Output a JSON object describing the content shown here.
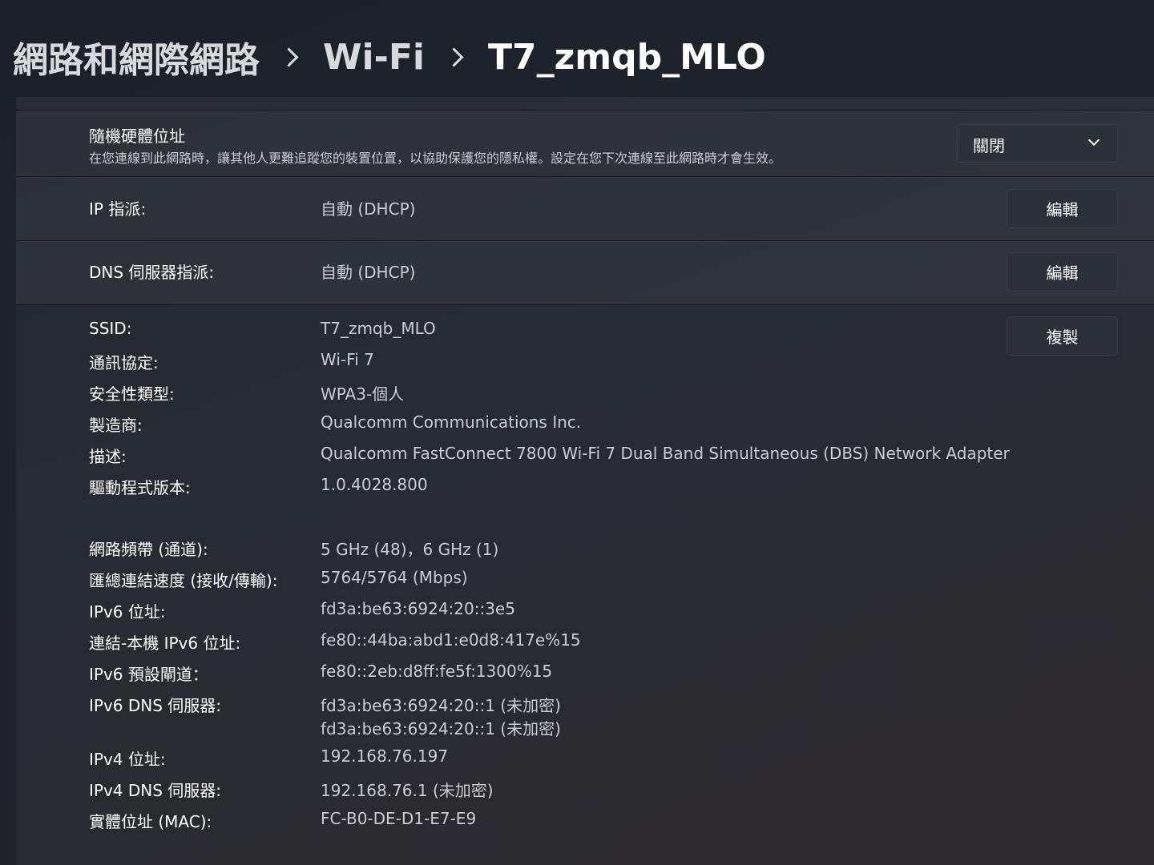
{
  "breadcrumb": {
    "items": [
      "網路和網際網路",
      "Wi-Fi",
      "T7_zmqb_MLO"
    ]
  },
  "random_hw": {
    "title": "隨機硬體位址",
    "description": "在您連線到此網路時，讓其他人更難追蹤您的裝置位置，以協助保護您的隱私權。設定在您下次連線至此網路時才會生效。",
    "dropdown_value": "關閉"
  },
  "ip_assignment": {
    "label": "IP 指派:",
    "value": "自動 (DHCP)",
    "button": "編輯"
  },
  "dns_assignment": {
    "label": "DNS 伺服器指派:",
    "value": "自動 (DHCP)",
    "button": "編輯"
  },
  "properties": {
    "copy_button": "複製",
    "ssid": {
      "label": "SSID:",
      "value": "T7_zmqb_MLO"
    },
    "protocol": {
      "label": "通訊協定:",
      "value": "Wi-Fi 7"
    },
    "security": {
      "label": "安全性類型:",
      "value": "WPA3-個人"
    },
    "manufacturer": {
      "label": "製造商:",
      "value": "Qualcomm Communications Inc."
    },
    "description": {
      "label": "描述:",
      "value": "Qualcomm FastConnect 7800 Wi-Fi 7 Dual Band Simultaneous (DBS) Network Adapter"
    },
    "driver": {
      "label": "驅動程式版本:",
      "value": "1.0.4028.800"
    },
    "band": {
      "label": "網路頻帶 (通道):",
      "value": "5 GHz (48)，6 GHz (1)"
    },
    "link_speed": {
      "label": "匯總連結速度 (接收/傳輸):",
      "value": "5764/5764 (Mbps)"
    },
    "ipv6": {
      "label": "IPv6 位址:",
      "value": "fd3a:be63:6924:20::3e5"
    },
    "link_local_ipv6": {
      "label": "連結-本機 IPv6 位址:",
      "value": "fe80::44ba:abd1:e0d8:417e%15"
    },
    "ipv6_gateway": {
      "label": "IPv6 預設閘道：",
      "value": "fe80::2eb:d8ff:fe5f:1300%15"
    },
    "ipv6_dns": {
      "label": "IPv6 DNS 伺服器:",
      "value1": "fd3a:be63:6924:20::1 (未加密)",
      "value2": "fd3a:be63:6924:20::1 (未加密)"
    },
    "ipv4": {
      "label": "IPv4 位址:",
      "value": "192.168.76.197"
    },
    "ipv4_dns": {
      "label": "IPv4 DNS 伺服器:",
      "value": "192.168.76.1 (未加密)"
    },
    "mac": {
      "label": "實體位址 (MAC):",
      "value": "FC-B0-DE-D1-E7-E9"
    }
  }
}
